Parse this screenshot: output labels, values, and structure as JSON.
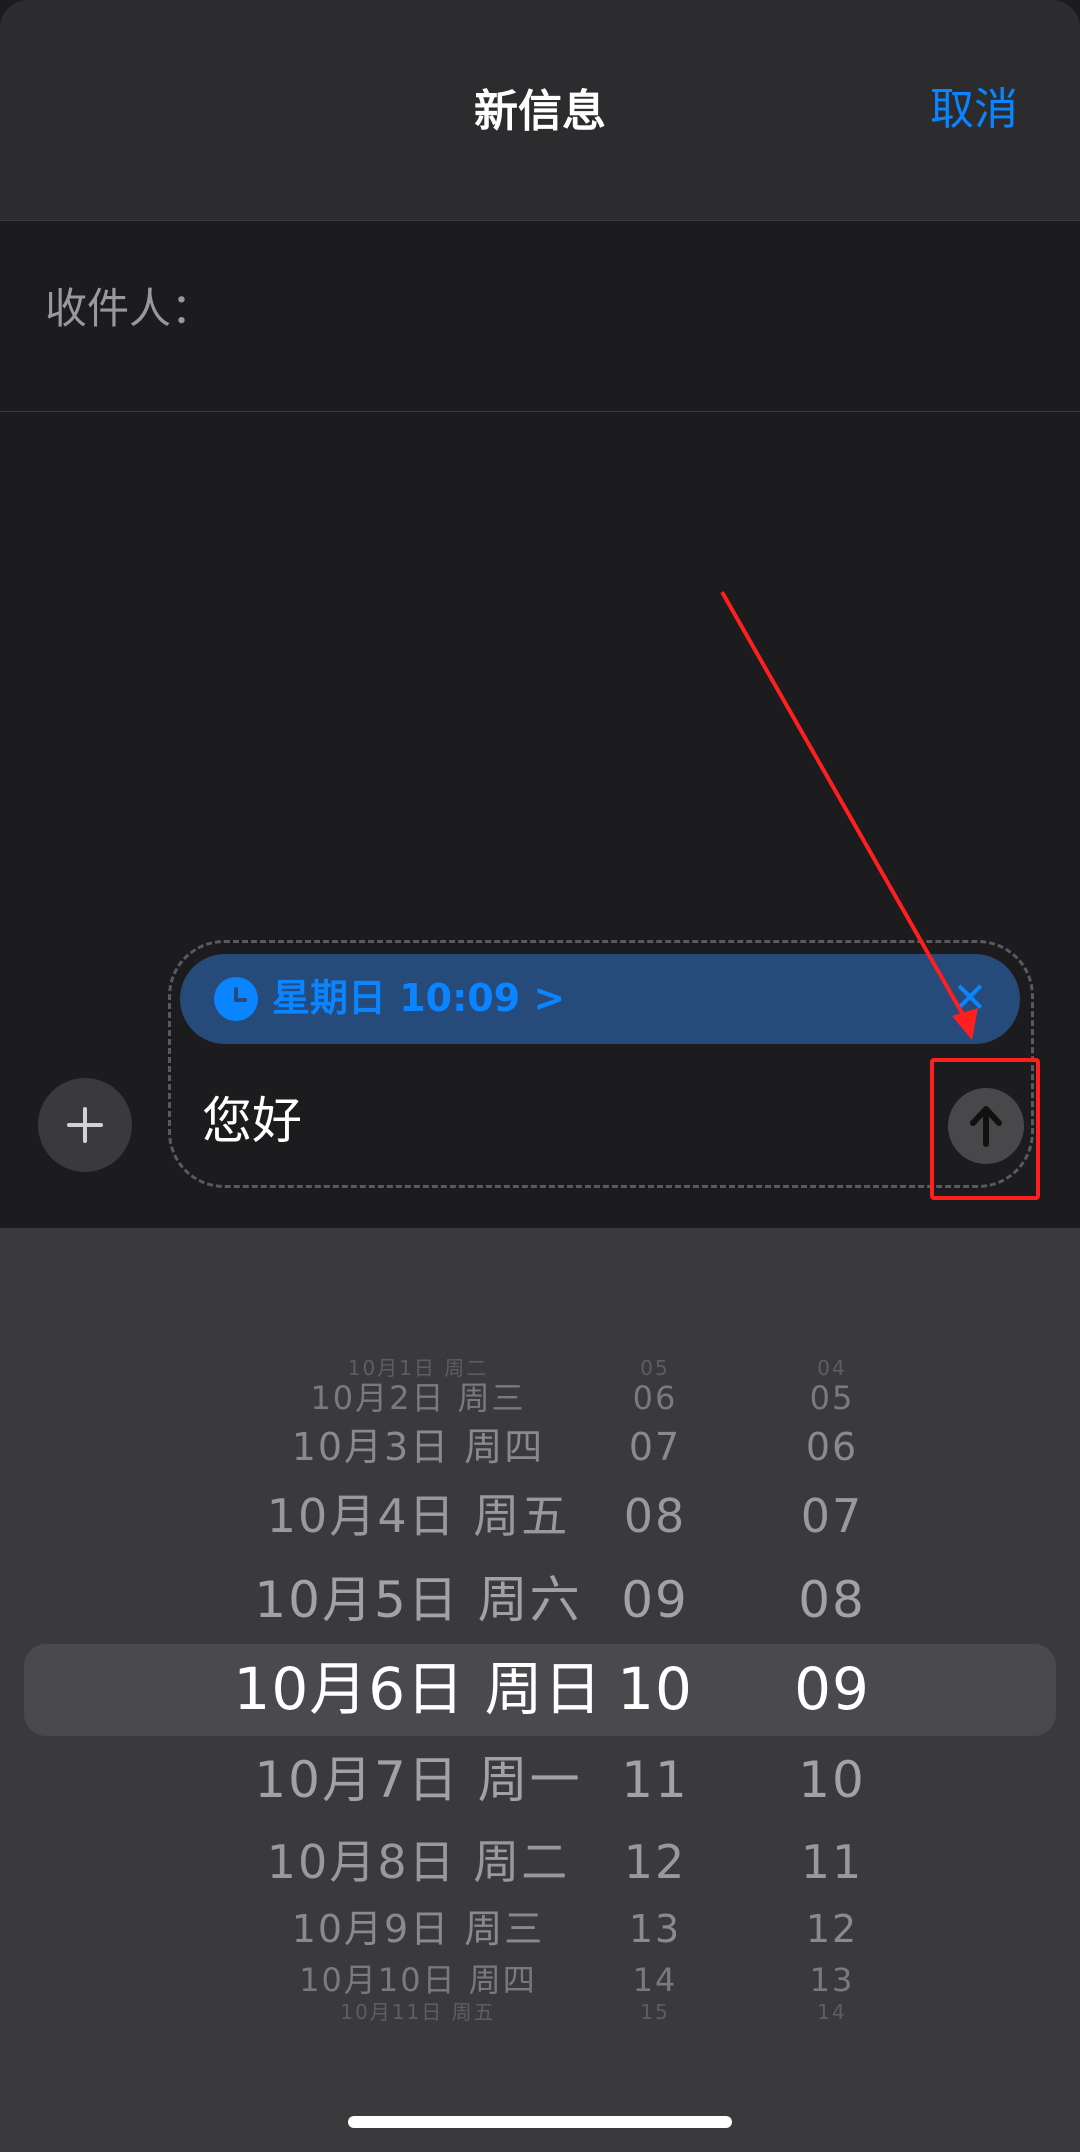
{
  "nav": {
    "title": "新信息",
    "cancel_label": "取消"
  },
  "recipient": {
    "label": "收件人："
  },
  "composer": {
    "schedule_label": "星期日 10:09 >",
    "close_label": "✕",
    "message": "您好"
  },
  "picker": {
    "rows": [
      {
        "date": "10月1日 周二",
        "hour": "05",
        "minute": "04"
      },
      {
        "date": "10月2日 周三",
        "hour": "06",
        "minute": "05"
      },
      {
        "date": "10月3日 周四",
        "hour": "07",
        "minute": "06"
      },
      {
        "date": "10月4日 周五",
        "hour": "08",
        "minute": "07"
      },
      {
        "date": "10月5日 周六",
        "hour": "09",
        "minute": "08"
      },
      {
        "date": "10月6日 周日",
        "hour": "10",
        "minute": "09"
      },
      {
        "date": "10月7日 周一",
        "hour": "11",
        "minute": "10"
      },
      {
        "date": "10月8日 周二",
        "hour": "12",
        "minute": "11"
      },
      {
        "date": "10月9日 周三",
        "hour": "13",
        "minute": "12"
      },
      {
        "date": "10月10日 周四",
        "hour": "14",
        "minute": "13"
      },
      {
        "date": "10月11日 周五",
        "hour": "15",
        "minute": "14"
      }
    ]
  },
  "colors": {
    "accent": "#0a84ff",
    "annotation": "#ff1f1f"
  },
  "icons": {
    "add": "plus-icon",
    "schedule": "clock-icon",
    "close": "close-icon",
    "send": "arrow-up-icon"
  }
}
